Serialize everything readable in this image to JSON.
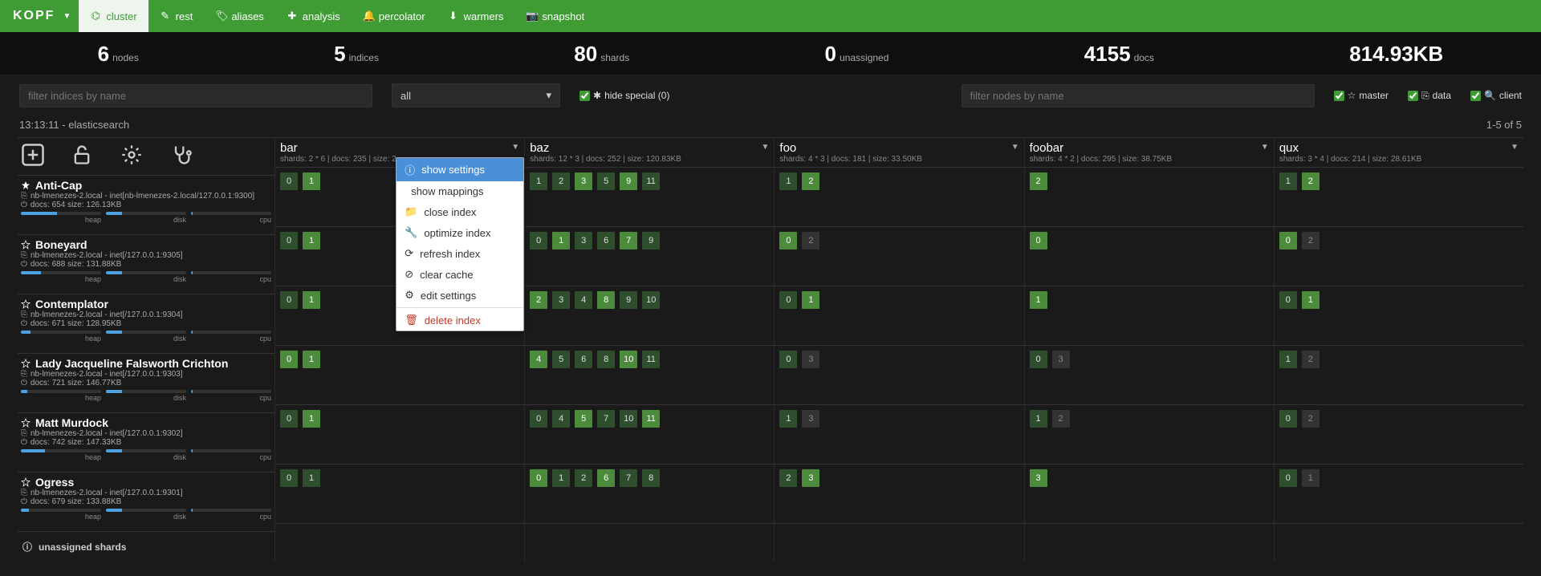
{
  "brand": "KOPF",
  "nav": [
    {
      "name": "cluster",
      "label": "cluster",
      "active": true,
      "icon": "sitemap"
    },
    {
      "name": "rest",
      "label": "rest",
      "icon": "pencil"
    },
    {
      "name": "aliases",
      "label": "aliases",
      "icon": "tags"
    },
    {
      "name": "analysis",
      "label": "analysis",
      "icon": "plus"
    },
    {
      "name": "percolator",
      "label": "percolator",
      "icon": "bell"
    },
    {
      "name": "warmers",
      "label": "warmers",
      "icon": "download"
    },
    {
      "name": "snapshot",
      "label": "snapshot",
      "icon": "camera"
    }
  ],
  "stats": {
    "nodes": {
      "num": "6",
      "lbl": "nodes"
    },
    "indices": {
      "num": "5",
      "lbl": "indices"
    },
    "shards": {
      "num": "80",
      "lbl": "shards"
    },
    "unass": {
      "num": "0",
      "lbl": "unassigned"
    },
    "docs": {
      "num": "4155",
      "lbl": "docs"
    },
    "size": {
      "num": "814.93KB",
      "lbl": ""
    }
  },
  "filters": {
    "indices_placeholder": "filter indices by name",
    "nodes_placeholder": "filter nodes by name",
    "select_label": "all",
    "hide_special": "hide special (0)",
    "master": "master",
    "data": "data",
    "client": "client"
  },
  "meta": {
    "left": "13:13:11 - elasticsearch",
    "right": "1-5 of 5"
  },
  "indices": [
    {
      "name": "bar",
      "meta": "shards: 2 * 6 | docs: 235 | size: 2"
    },
    {
      "name": "baz",
      "meta": "shards: 12 * 3 | docs: 252 | size: 120.83KB"
    },
    {
      "name": "foo",
      "meta": "shards: 4 * 3 | docs: 181 | size: 33.50KB"
    },
    {
      "name": "foobar",
      "meta": "shards: 4 * 2 | docs: 295 | size: 38.75KB"
    },
    {
      "name": "qux",
      "meta": "shards: 3 * 4 | docs: 214 | size: 28.61KB"
    }
  ],
  "index_menu": {
    "items": [
      {
        "label": "show settings",
        "icon": "info",
        "active": true
      },
      {
        "label": "show mappings",
        "icon": "code"
      },
      {
        "label": "close index",
        "icon": "folder"
      },
      {
        "label": "optimize index",
        "icon": "wrench"
      },
      {
        "label": "refresh index",
        "icon": "refresh"
      },
      {
        "label": "clear cache",
        "icon": "ban"
      },
      {
        "label": "edit settings",
        "icon": "gear"
      }
    ],
    "danger": {
      "label": "delete index",
      "icon": "trash"
    }
  },
  "nodes": [
    {
      "name": "Anti-Cap",
      "star": "fill",
      "addr": "nb-lmenezes-2.local - inet[nb-lmenezes-2.local/127.0.0.1:9300]",
      "stats": "docs: 654  size: 126.13KB",
      "heap": 45,
      "disk": 20,
      "cpu": 2
    },
    {
      "name": "Boneyard",
      "star": "out",
      "addr": "nb-lmenezes-2.local - inet[/127.0.0.1:9305]",
      "stats": "docs: 688  size: 131.88KB",
      "heap": 25,
      "disk": 20,
      "cpu": 2
    },
    {
      "name": "Contemplator",
      "star": "out",
      "addr": "nb-lmenezes-2.local - inet[/127.0.0.1:9304]",
      "stats": "docs: 671  size: 128.95KB",
      "heap": 12,
      "disk": 20,
      "cpu": 2
    },
    {
      "name": "Lady Jacqueline Falsworth Crichton",
      "star": "out",
      "addr": "nb-lmenezes-2.local - inet[/127.0.0.1:9303]",
      "stats": "docs: 721  size: 146.77KB",
      "heap": 8,
      "disk": 20,
      "cpu": 2
    },
    {
      "name": "Matt Murdock",
      "star": "out",
      "addr": "nb-lmenezes-2.local - inet[/127.0.0.1:9302]",
      "stats": "docs: 742  size: 147.33KB",
      "heap": 30,
      "disk": 20,
      "cpu": 2
    },
    {
      "name": "Ogress",
      "star": "out",
      "addr": "nb-lmenezes-2.local - inet[/127.0.0.1:9301]",
      "stats": "docs: 679  size: 133.88KB",
      "heap": 10,
      "disk": 20,
      "cpu": 2
    }
  ],
  "bar_labels": {
    "heap": "heap",
    "disk": "disk",
    "cpu": "cpu"
  },
  "shards": {
    "bar": [
      [
        {
          "n": "0"
        },
        {
          "n": "1",
          "p": true
        }
      ],
      [
        {
          "n": "0"
        },
        {
          "n": "1",
          "p": true
        }
      ],
      [
        {
          "n": "0"
        },
        {
          "n": "1",
          "p": true
        }
      ],
      [
        {
          "n": "0",
          "p": true
        },
        {
          "n": "1",
          "p": true
        }
      ],
      [
        {
          "n": "0"
        },
        {
          "n": "1",
          "p": true
        }
      ],
      [
        {
          "n": "0"
        },
        {
          "n": "1"
        }
      ]
    ],
    "baz": [
      [
        {
          "n": "1"
        },
        {
          "n": "2"
        },
        {
          "n": "3",
          "p": true
        },
        {
          "n": "5"
        },
        {
          "n": "9",
          "p": true
        },
        {
          "n": "11"
        }
      ],
      [
        {
          "n": "0"
        },
        {
          "n": "1",
          "p": true
        },
        {
          "n": "3"
        },
        {
          "n": "6"
        },
        {
          "n": "7",
          "p": true
        },
        {
          "n": "9"
        }
      ],
      [
        {
          "n": "2",
          "p": true
        },
        {
          "n": "3"
        },
        {
          "n": "4"
        },
        {
          "n": "8",
          "p": true
        },
        {
          "n": "9"
        },
        {
          "n": "10"
        }
      ],
      [
        {
          "n": "4",
          "p": true
        },
        {
          "n": "5"
        },
        {
          "n": "6"
        },
        {
          "n": "8"
        },
        {
          "n": "10",
          "p": true
        },
        {
          "n": "11"
        }
      ],
      [
        {
          "n": "0"
        },
        {
          "n": "4"
        },
        {
          "n": "5",
          "p": true
        },
        {
          "n": "7"
        },
        {
          "n": "10"
        },
        {
          "n": "11",
          "p": true
        }
      ],
      [
        {
          "n": "0",
          "p": true
        },
        {
          "n": "1"
        },
        {
          "n": "2"
        },
        {
          "n": "6",
          "p": true
        },
        {
          "n": "7"
        },
        {
          "n": "8"
        }
      ]
    ],
    "foo": [
      [
        {
          "n": "1"
        },
        {
          "n": "2",
          "p": true
        }
      ],
      [
        {
          "n": "0",
          "p": true
        },
        {
          "n": "2",
          "d": true
        }
      ],
      [
        {
          "n": "0"
        },
        {
          "n": "1",
          "p": true
        }
      ],
      [
        {
          "n": "0"
        },
        {
          "n": "3",
          "d": true
        }
      ],
      [
        {
          "n": "1"
        },
        {
          "n": "3",
          "d": true
        }
      ],
      [
        {
          "n": "2"
        },
        {
          "n": "3",
          "p": true
        }
      ]
    ],
    "foobar": [
      [
        {
          "n": "2",
          "p": true
        }
      ],
      [
        {
          "n": "0",
          "p": true
        }
      ],
      [
        {
          "n": "1",
          "p": true
        }
      ],
      [
        {
          "n": "0"
        },
        {
          "n": "3",
          "d": true
        }
      ],
      [
        {
          "n": "1"
        },
        {
          "n": "2",
          "d": true
        }
      ],
      [
        {
          "n": "3",
          "p": true
        }
      ]
    ],
    "qux": [
      [
        {
          "n": "1"
        },
        {
          "n": "2",
          "p": true
        }
      ],
      [
        {
          "n": "0",
          "p": true
        },
        {
          "n": "2",
          "d": true
        }
      ],
      [
        {
          "n": "0"
        },
        {
          "n": "1",
          "p": true
        }
      ],
      [
        {
          "n": "1"
        },
        {
          "n": "2",
          "d": true
        }
      ],
      [
        {
          "n": "0"
        },
        {
          "n": "2",
          "d": true
        }
      ],
      [
        {
          "n": "0"
        },
        {
          "n": "1",
          "d": true
        }
      ]
    ]
  },
  "unassigned_label": "unassigned shards"
}
